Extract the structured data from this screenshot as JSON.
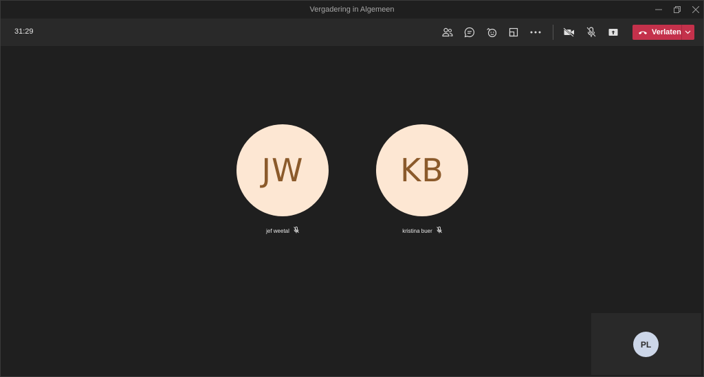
{
  "window": {
    "title": "Vergadering in Algemeen"
  },
  "toolbar": {
    "timer": "31:29",
    "leave_label": "Verlaten",
    "icons": [
      "participants-icon",
      "chat-icon",
      "reactions-icon",
      "room-view-icon",
      "more-options-icon",
      "camera-off-icon",
      "mic-muted-icon",
      "share-screen-icon"
    ]
  },
  "participants": [
    {
      "initials": "JW",
      "name": "jef weetal",
      "muted": true
    },
    {
      "initials": "KB",
      "name": "kristina buer",
      "muted": true
    }
  ],
  "self": {
    "initials": "PL"
  },
  "colors": {
    "background": "#1f1f1f",
    "toolbar": "#292929",
    "leave": "#c4314b",
    "avatar_large_bg": "#fde7d3",
    "avatar_large_text": "#8b5a2b",
    "avatar_small_bg": "#ccd6e8"
  }
}
